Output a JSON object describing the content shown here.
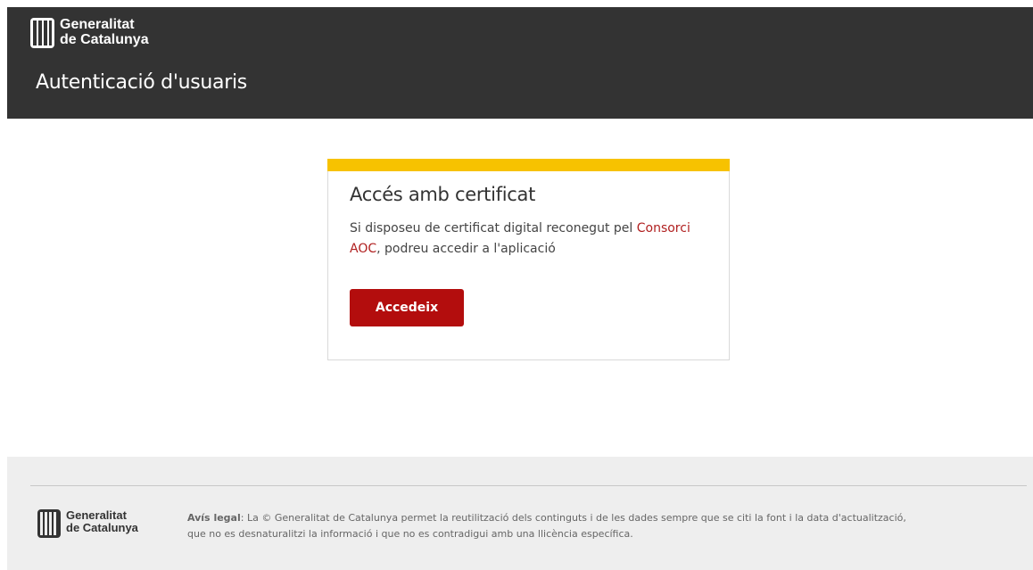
{
  "header": {
    "brand_line1": "Generalitat",
    "brand_line2": "de Catalunya",
    "title": "Autenticació d'usuaris",
    "logo_icon": "generalitat-logo-icon"
  },
  "card": {
    "title": "Accés amb certificat",
    "text_before_link": "Si disposeu de certificat digital reconegut pel ",
    "link_text": "Consorci AOC",
    "text_after_link": ", podreu accedir a l'aplicació",
    "button_label": "Accedeix",
    "accent_color": "#f7c200",
    "button_color": "#b30d0d"
  },
  "footer": {
    "brand_line1": "Generalitat",
    "brand_line2": "de Catalunya",
    "legal_label": "Avís legal",
    "legal_text": ": La © Generalitat de Catalunya permet la reutilització dels continguts i de les dades sempre que se citi la font i la data d'actualització, que no es desnaturalitzi la informació i que no es contradigui amb una llicència específica."
  }
}
